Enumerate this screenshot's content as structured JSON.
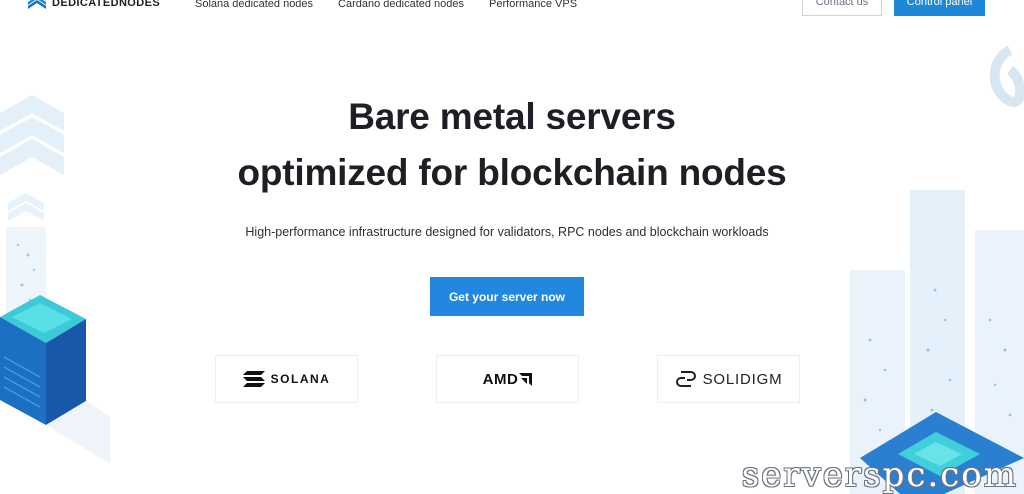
{
  "header": {
    "logo_text": "DEDICATEDNODES",
    "nav": [
      "Solana dedicated nodes",
      "Cardano dedicated nodes",
      "Performance VPS"
    ],
    "contact_label": "Contact us",
    "control_panel_label": "Control panel"
  },
  "hero": {
    "title_line1": "Bare metal servers",
    "title_line2": "optimized for blockchain nodes",
    "subtitle": "High-performance infrastructure designed for validators, RPC nodes and blockchain workloads",
    "cta_label": "Get your server now"
  },
  "partners": [
    {
      "name": "SOLANA",
      "icon": "solana-logo-icon"
    },
    {
      "name": "AMD",
      "icon": "amd-arrow-icon"
    },
    {
      "name": "SOLIDIGM",
      "icon": "solidigm-logo-icon"
    }
  ],
  "watermark": "serverspc.com",
  "colors": {
    "accent": "#2287de",
    "text": "#1d1f24",
    "deco_light": "#dbeaf7",
    "deco_teal": "#32c6d8"
  }
}
